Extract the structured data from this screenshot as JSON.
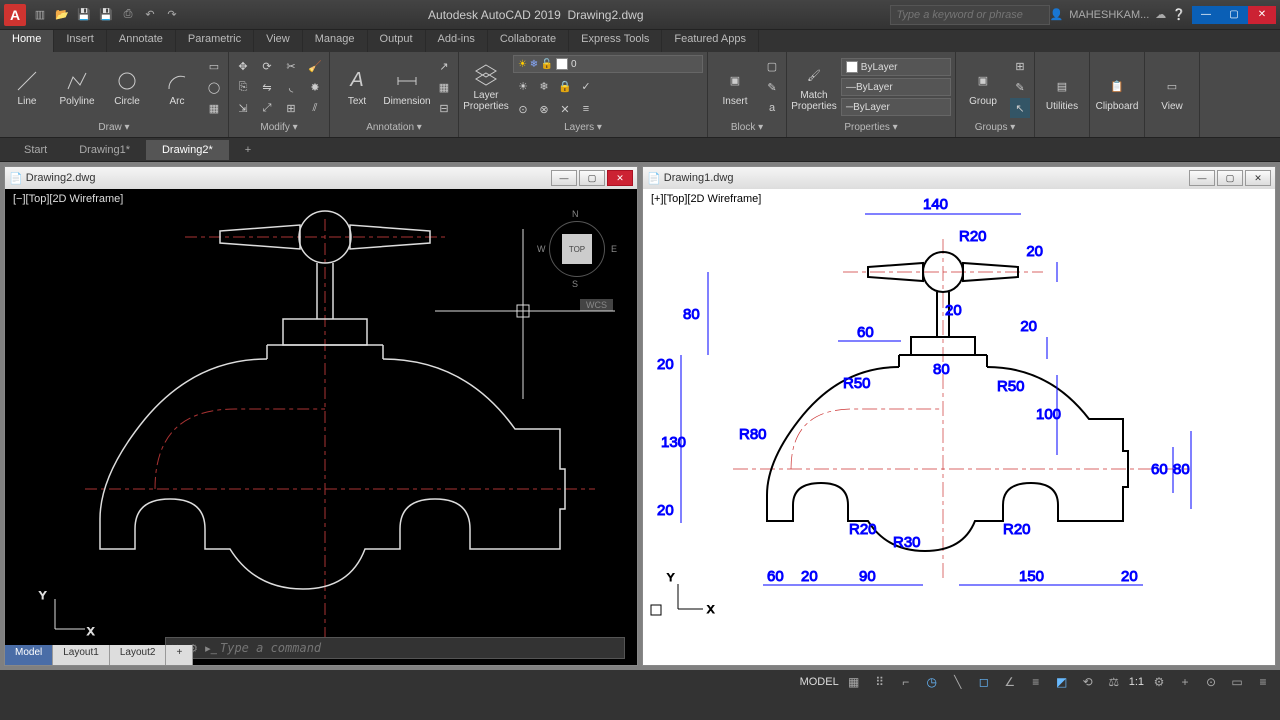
{
  "app": {
    "name": "Autodesk AutoCAD 2019",
    "document": "Drawing2.dwg",
    "searchPlaceholder": "Type a keyword or phrase",
    "user": "MAHESHKAM..."
  },
  "ribbonTabs": [
    "Home",
    "Insert",
    "Annotate",
    "Parametric",
    "View",
    "Manage",
    "Output",
    "Add-ins",
    "Collaborate",
    "Express Tools",
    "Featured Apps"
  ],
  "activeRibbonTab": 0,
  "draw": {
    "line": "Line",
    "polyline": "Polyline",
    "circle": "Circle",
    "arc": "Arc",
    "label": "Draw ▾"
  },
  "modify": {
    "label": "Modify ▾"
  },
  "annotation": {
    "text": "Text",
    "dim": "Dimension",
    "label": "Annotation ▾"
  },
  "layers": {
    "btn": "Layer\nProperties",
    "combo": "0",
    "label": "Layers ▾"
  },
  "block": {
    "insert": "Insert",
    "label": "Block ▾"
  },
  "properties": {
    "match": "Match\nProperties",
    "lyr": "ByLayer",
    "lt": "ByLayer",
    "lw": "ByLayer",
    "label": "Properties ▾"
  },
  "groups": {
    "btn": "Group",
    "label": "Groups ▾"
  },
  "utilities": {
    "label": "Utilities"
  },
  "clipboard": {
    "label": "Clipboard"
  },
  "view": {
    "label": "View"
  },
  "docTabs": [
    "Start",
    "Drawing1*",
    "Drawing2*"
  ],
  "activeDocTab": 2,
  "windows": {
    "left": {
      "title": "Drawing2.dwg",
      "viewLabel": "[−][Top][2D Wireframe]",
      "navcube": {
        "top": "N",
        "bottom": "S",
        "left": "W",
        "right": "E",
        "face": "TOP",
        "wcs": "WCS"
      }
    },
    "right": {
      "title": "Drawing1.dwg",
      "viewLabel": "[+][Top][2D Wireframe]"
    }
  },
  "dims": {
    "d140": "140",
    "r20": "R20",
    "d20a": "20",
    "d80a": "80",
    "d20b": "20",
    "d60": "60",
    "d20c": "20",
    "r50a": "R50",
    "r50b": "R50",
    "d80b": "80",
    "d20d": "20",
    "d100": "100",
    "d130": "130",
    "r80": "R80",
    "d60b": "60",
    "d80c": "80",
    "d20e": "20",
    "r20b": "R20",
    "r30": "R30",
    "r20c": "R20",
    "d60c": "60",
    "d20f": "20",
    "d90": "90",
    "d150": "150",
    "d20g": "20"
  },
  "cmd": {
    "placeholder": "Type a command"
  },
  "bottomTabs": [
    "Model",
    "Layout1",
    "Layout2"
  ],
  "activeBottomTab": 0,
  "status": {
    "model": "MODEL",
    "scale": "1:1"
  }
}
